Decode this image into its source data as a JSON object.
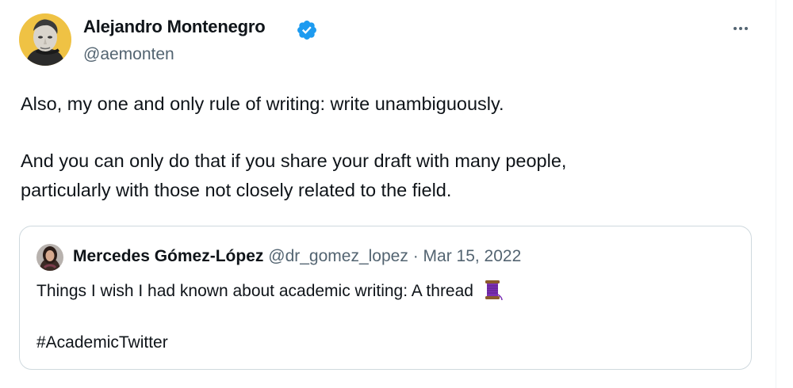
{
  "tweet": {
    "author_name": "Alejandro Montenegro",
    "author_handle": "@aemonten",
    "verified": true,
    "text_line_1": "Also, my one and only rule of writing: write unambiguously.",
    "text_line_2": "And you can only do that if you share your draft with many people,",
    "text_line_3": "particularly with those not closely related to the field."
  },
  "quoted_tweet": {
    "author_name": "Mercedes Gómez-López",
    "author_handle": "@dr_gomez_lopez",
    "separator": "·",
    "date": "Mar 15, 2022",
    "text": "Things I wish I had known about academic writing: A thread",
    "emoji": "spool-of-thread-icon",
    "hashtag": "#AcademicTwitter"
  },
  "icons": {
    "verified": "verified-badge-icon",
    "more": "more-options-icon"
  },
  "colors": {
    "primary_text": "#0f1419",
    "secondary_text": "#536471",
    "verified_blue": "#1d9bf0",
    "card_border": "#cfd9de",
    "divider": "#eff3f4"
  }
}
